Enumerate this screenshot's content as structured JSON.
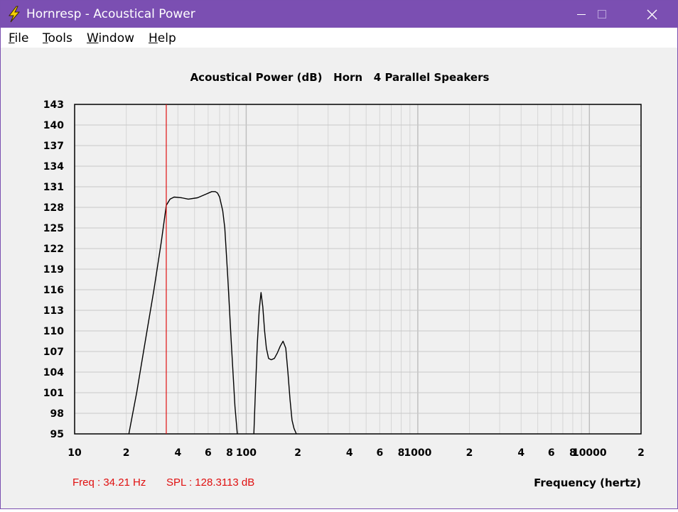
{
  "window": {
    "title": "Hornresp - Acoustical Power",
    "controls": [
      "minimize",
      "maximize",
      "close"
    ]
  },
  "menu": {
    "items": [
      {
        "label": "File",
        "accel": "F",
        "rest": "ile"
      },
      {
        "label": "Tools",
        "accel": "T",
        "rest": "ools"
      },
      {
        "label": "Window",
        "accel": "W",
        "rest": "indow"
      },
      {
        "label": "Help",
        "accel": "H",
        "rest": "elp"
      }
    ]
  },
  "colors": {
    "titlebar": "#7b4fb2",
    "curve": "#000000",
    "cursor": "#e01010",
    "grid": "#c8c8c8",
    "background": "#f0f0f0"
  },
  "readout": {
    "freq": "Freq : 34.21 Hz",
    "spl": "SPL : 128.3113 dB"
  },
  "chart_data": {
    "type": "line",
    "title": "Acoustical Power (dB)   Horn   4 Parallel Speakers",
    "xlabel": "Frequency (hertz)",
    "ylabel": "",
    "x_scale": "log",
    "xlim": [
      10,
      20000
    ],
    "ylim": [
      95,
      143
    ],
    "grid": true,
    "y_ticks": [
      "143",
      "140",
      "137",
      "134",
      "131",
      "128",
      "125",
      "122",
      "119",
      "116",
      "113",
      "110",
      "107",
      "104",
      "101",
      "98",
      "95"
    ],
    "x_ticks": [
      {
        "value": 10,
        "label": "10"
      },
      {
        "value": 20,
        "label": "2"
      },
      {
        "value": 40,
        "label": "4"
      },
      {
        "value": 60,
        "label": "6"
      },
      {
        "value": 80,
        "label": "8"
      },
      {
        "value": 100,
        "label": "100"
      },
      {
        "value": 200,
        "label": "2"
      },
      {
        "value": 400,
        "label": "4"
      },
      {
        "value": 600,
        "label": "6"
      },
      {
        "value": 800,
        "label": "8"
      },
      {
        "value": 1000,
        "label": "1000"
      },
      {
        "value": 2000,
        "label": "2"
      },
      {
        "value": 4000,
        "label": "4"
      },
      {
        "value": 6000,
        "label": "6"
      },
      {
        "value": 8000,
        "label": "8"
      },
      {
        "value": 10000,
        "label": "10000"
      },
      {
        "value": 20000,
        "label": "2"
      }
    ],
    "cursor_freq": 34.21,
    "segments": [
      {
        "x": [
          20.7,
          23,
          26,
          29,
          32,
          34.21,
          36,
          38,
          42,
          46,
          52,
          58,
          63,
          66,
          68,
          70,
          73,
          75,
          78,
          82,
          86,
          88.7
        ],
        "y": [
          95,
          101,
          109,
          116,
          123,
          128.3,
          129.2,
          129.5,
          129.4,
          129.2,
          129.4,
          129.9,
          130.3,
          130.3,
          130.1,
          129.5,
          127.5,
          125,
          118,
          108,
          99,
          95
        ]
      },
      {
        "x": [
          110.8,
          113,
          116,
          119,
          122,
          125,
          128,
          131,
          135,
          140,
          146,
          152,
          158,
          164,
          170,
          175,
          180,
          185,
          190,
          196
        ],
        "y": [
          95,
          101,
          108,
          113,
          115.6,
          113.5,
          110,
          107.5,
          106,
          105.8,
          106,
          106.8,
          107.8,
          108.5,
          107.5,
          104,
          100,
          97,
          95.8,
          95
        ]
      }
    ]
  }
}
